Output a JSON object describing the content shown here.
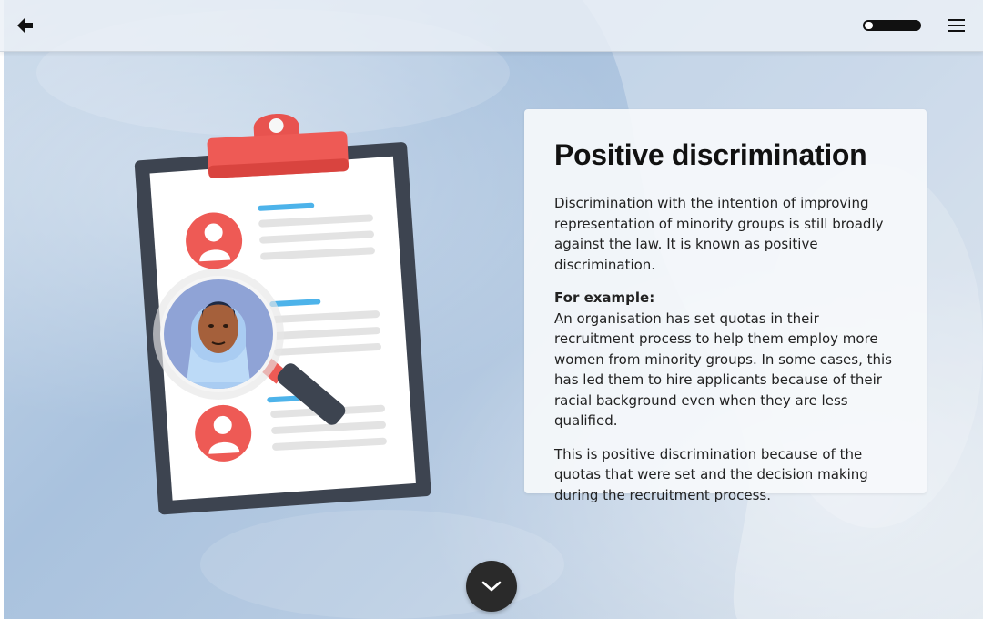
{
  "topbar": {
    "back_icon": "arrow-left-icon",
    "menu_icon": "hamburger-menu-icon",
    "progress": 0.15
  },
  "content": {
    "title": "Positive discrimination",
    "paragraph_1": "Discrimination with the intention of improving representation of minority groups is still broadly against the law. It is known as positive discrimination.",
    "example_heading": "For example:",
    "example_text": "An organisation has set quotas in their recruitment process to help them employ more women from minority groups. In some cases, this has led them to hire applicants because of their racial background even when they are less qualified.",
    "paragraph_3": "This is positive discrimination because of the quotas that were set and the decision making during the recruitment process."
  },
  "navigation": {
    "scroll_down_icon": "chevron-down-icon"
  },
  "colors": {
    "clipboard_border": "#3d4450",
    "clip_red": "#e8534f",
    "avatar_red": "#ee5a55",
    "accent_blue": "#4db3ea",
    "line_grey": "#e3e3e3",
    "dark_button": "#2a2a2a"
  }
}
